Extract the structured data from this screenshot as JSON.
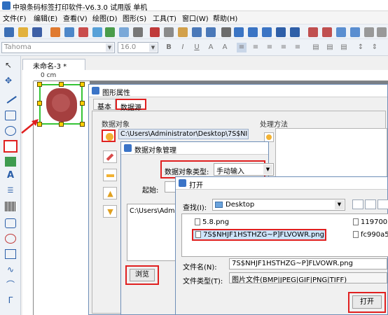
{
  "window": {
    "title": "中琅条码标签打印软件-V6.3.0 试用版 单机"
  },
  "menu": [
    "文件(F)",
    "编辑(E)",
    "查看(V)",
    "绘图(D)",
    "图形(S)",
    "工具(T)",
    "窗口(W)",
    "帮助(H)"
  ],
  "format_bar": {
    "font": "Tahoma",
    "size": "16.0"
  },
  "document": {
    "tab_title": "未命名-3 *",
    "ruler_unit": "0 cm"
  },
  "shape_props_dialog": {
    "title": "图形属性",
    "tabs": [
      "基本",
      "数据源"
    ],
    "data_object_label": "数据对象",
    "data_path": "C:\\Users\\Administrator\\Desktop\\7S$NI",
    "process_method_label": "处理方法"
  },
  "data_mgr_dialog": {
    "title": "数据对象管理",
    "type_label": "数据对象类型:",
    "type_value": "手动输入",
    "start_label": "起始:",
    "list_value": "C:\\Users\\Adm",
    "browse_label": "浏览"
  },
  "open_dialog": {
    "title": "打开",
    "look_in_label": "查找(I):",
    "look_in_value": "Desktop",
    "files": [
      {
        "name": "5.8.png"
      },
      {
        "name": "7S$NHJF1HSTHZG~P]FLVOWR.png"
      }
    ],
    "files_right": [
      {
        "name": "119700"
      },
      {
        "name": "fc990a5"
      }
    ],
    "filename_label": "文件名(N):",
    "filename_value": "7S$NHJF1HSTHZG~P]FLVOWR.png",
    "filetype_label": "文件类型(T):",
    "filetype_value": "图片文件(BMP|JPEG|GIF|PNG|TIFF)",
    "open_button": "打开"
  },
  "colors": {
    "highlight_red": "#e02020",
    "selection_green": "#36c436",
    "handle_yellow": "#ffd000"
  }
}
